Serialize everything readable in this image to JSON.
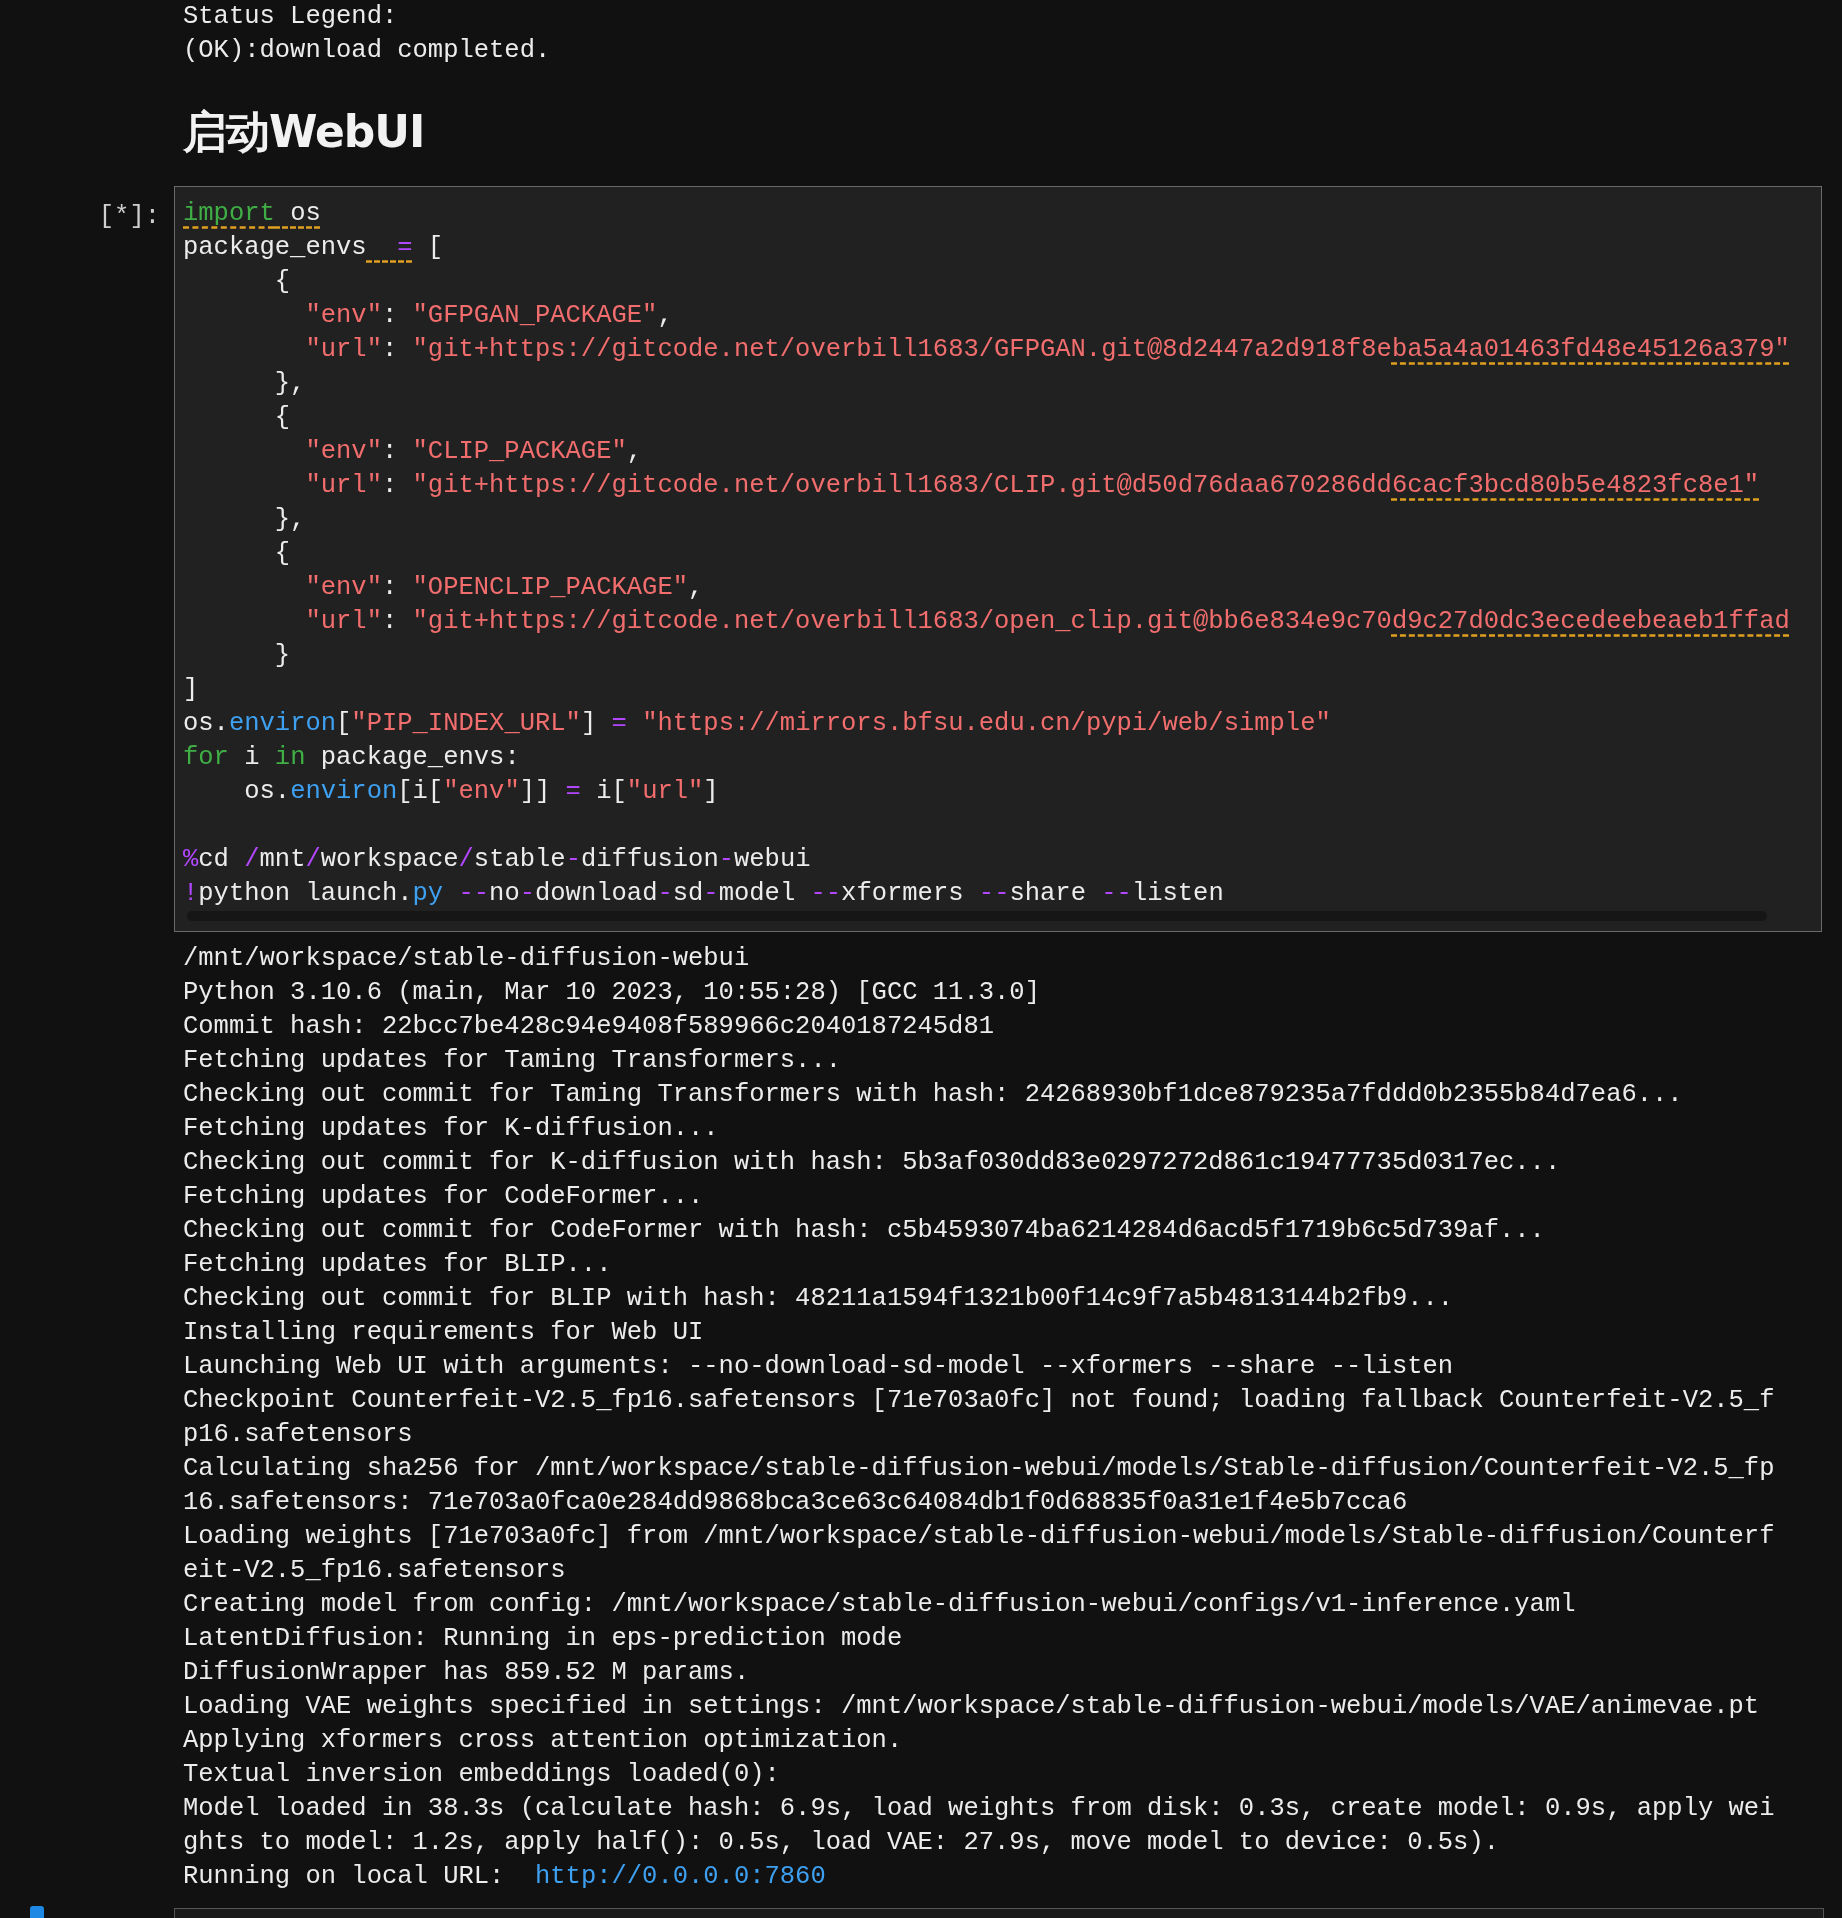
{
  "previous_output": [
    "Status Legend:",
    "(OK):download completed."
  ],
  "heading": "启动WebUI",
  "cell": {
    "prompt": "[*]:",
    "running": true,
    "code_blocks": [
      [
        [
          {
            "kind": "keyword",
            "t": "import",
            "lint": true
          },
          {
            "kind": "plain",
            "t": " os",
            "lint": true
          }
        ],
        [
          {
            "kind": "plain",
            "t": "package_envs"
          },
          {
            "kind": "operator",
            "t": "  =",
            "lint": true
          },
          {
            "kind": "plain",
            "t": " ["
          }
        ],
        [
          {
            "kind": "plain",
            "t": "      {"
          }
        ],
        [
          {
            "kind": "string",
            "t": "        \"env\""
          },
          {
            "kind": "plain",
            "t": ": "
          },
          {
            "kind": "string",
            "t": "\"GFPGAN_PACKAGE\""
          },
          {
            "kind": "plain",
            "t": ","
          }
        ],
        [
          {
            "kind": "string",
            "t": "        \"url\""
          },
          {
            "kind": "plain",
            "t": ": "
          },
          {
            "kind": "string",
            "t": "\"git+https://gitcode.net/overbill1683/GFPGAN.git@8d2447a2d918f8e"
          },
          {
            "kind": "string",
            "t": "ba5a4a01463fd48e45126a379\"",
            "lint": true
          }
        ],
        [
          {
            "kind": "plain",
            "t": "      },"
          }
        ],
        [
          {
            "kind": "plain",
            "t": "      {"
          }
        ],
        [
          {
            "kind": "string",
            "t": "        \"env\""
          },
          {
            "kind": "plain",
            "t": ": "
          },
          {
            "kind": "string",
            "t": "\"CLIP_PACKAGE\""
          },
          {
            "kind": "plain",
            "t": ","
          }
        ],
        [
          {
            "kind": "string",
            "t": "        \"url\""
          },
          {
            "kind": "plain",
            "t": ": "
          },
          {
            "kind": "string",
            "t": "\"git+https://gitcode.net/overbill1683/CLIP.git@d50d76daa670286dd"
          },
          {
            "kind": "string",
            "t": "6cacf3bcd80b5e4823fc8e1\"",
            "lint": true
          }
        ],
        [
          {
            "kind": "plain",
            "t": "      },"
          }
        ],
        [
          {
            "kind": "plain",
            "t": "      {"
          }
        ],
        [
          {
            "kind": "string",
            "t": "        \"env\""
          },
          {
            "kind": "plain",
            "t": ": "
          },
          {
            "kind": "string",
            "t": "\"OPENCLIP_PACKAGE\""
          },
          {
            "kind": "plain",
            "t": ","
          }
        ],
        [
          {
            "kind": "string",
            "t": "        \"url\""
          },
          {
            "kind": "plain",
            "t": ": "
          },
          {
            "kind": "string",
            "t": "\"git+https://gitcode.net/overbill1683/open_clip.git@bb6e834e9c70"
          },
          {
            "kind": "string",
            "t": "d9c27d0dc3ecedeebeaeb1ffad",
            "lint": true
          }
        ],
        [
          {
            "kind": "plain",
            "t": "      }"
          }
        ],
        [
          {
            "kind": "plain",
            "t": "]"
          }
        ],
        [
          {
            "kind": "plain",
            "t": "os."
          },
          {
            "kind": "attribute",
            "t": "environ"
          },
          {
            "kind": "plain",
            "t": "["
          },
          {
            "kind": "string",
            "t": "\"PIP_INDEX_URL\""
          },
          {
            "kind": "plain",
            "t": "] "
          },
          {
            "kind": "operator",
            "t": "="
          },
          {
            "kind": "string",
            "t": " \"https://mirrors.bfsu.edu.cn/pypi/web/simple\""
          }
        ],
        [
          {
            "kind": "keyword",
            "t": "for"
          },
          {
            "kind": "plain",
            "t": " i "
          },
          {
            "kind": "keyword",
            "t": "in"
          },
          {
            "kind": "plain",
            "t": " package_envs:"
          }
        ],
        [
          {
            "kind": "plain",
            "t": "    os."
          },
          {
            "kind": "attribute",
            "t": "environ"
          },
          {
            "kind": "plain",
            "t": "[i["
          },
          {
            "kind": "string",
            "t": "\"env\""
          },
          {
            "kind": "plain",
            "t": "]] "
          },
          {
            "kind": "operator",
            "t": "="
          },
          {
            "kind": "plain",
            "t": " i["
          },
          {
            "kind": "string",
            "t": "\"url\""
          },
          {
            "kind": "plain",
            "t": "]"
          }
        ]
      ],
      [
        [
          {
            "kind": "operator",
            "t": "%"
          },
          {
            "kind": "plain",
            "t": "cd "
          },
          {
            "kind": "operator",
            "t": "/"
          },
          {
            "kind": "plain",
            "t": "mnt"
          },
          {
            "kind": "operator",
            "t": "/"
          },
          {
            "kind": "plain",
            "t": "workspace"
          },
          {
            "kind": "operator",
            "t": "/"
          },
          {
            "kind": "plain",
            "t": "stable"
          },
          {
            "kind": "operator",
            "t": "-"
          },
          {
            "kind": "plain",
            "t": "diffusion"
          },
          {
            "kind": "operator",
            "t": "-"
          },
          {
            "kind": "plain",
            "t": "webui"
          }
        ],
        [
          {
            "kind": "operator",
            "t": "!"
          },
          {
            "kind": "plain",
            "t": "python launch."
          },
          {
            "kind": "attribute",
            "t": "py"
          },
          {
            "kind": "operator",
            "t": " --"
          },
          {
            "kind": "plain",
            "t": "no"
          },
          {
            "kind": "operator",
            "t": "-"
          },
          {
            "kind": "plain",
            "t": "download"
          },
          {
            "kind": "operator",
            "t": "-"
          },
          {
            "kind": "plain",
            "t": "sd"
          },
          {
            "kind": "operator",
            "t": "-"
          },
          {
            "kind": "plain",
            "t": "model "
          },
          {
            "kind": "operator",
            "t": "--"
          },
          {
            "kind": "plain",
            "t": "xformers "
          },
          {
            "kind": "operator",
            "t": "--"
          },
          {
            "kind": "plain",
            "t": "share "
          },
          {
            "kind": "operator",
            "t": "--"
          },
          {
            "kind": "plain",
            "t": "listen"
          }
        ]
      ]
    ]
  },
  "output": [
    {
      "text": "/mnt/workspace/stable-diffusion-webui"
    },
    {
      "text": "Python 3.10.6 (main, Mar 10 2023, 10:55:28) [GCC 11.3.0]"
    },
    {
      "text": "Commit hash: 22bcc7be428c94e9408f589966c2040187245d81"
    },
    {
      "text": "Fetching updates for Taming Transformers..."
    },
    {
      "text": "Checking out commit for Taming Transformers with hash: 24268930bf1dce879235a7fddd0b2355b84d7ea6..."
    },
    {
      "text": "Fetching updates for K-diffusion..."
    },
    {
      "text": "Checking out commit for K-diffusion with hash: 5b3af030dd83e0297272d861c19477735d0317ec..."
    },
    {
      "text": "Fetching updates for CodeFormer..."
    },
    {
      "text": "Checking out commit for CodeFormer with hash: c5b4593074ba6214284d6acd5f1719b6c5d739af..."
    },
    {
      "text": "Fetching updates for BLIP..."
    },
    {
      "text": "Checking out commit for BLIP with hash: 48211a1594f1321b00f14c9f7a5b4813144b2fb9..."
    },
    {
      "text": "Installing requirements for Web UI"
    },
    {
      "text": "Launching Web UI with arguments: --no-download-sd-model --xformers --share --listen"
    },
    {
      "text": "Checkpoint Counterfeit-V2.5_fp16.safetensors [71e703a0fc] not found; loading fallback Counterfeit-V2.5_f"
    },
    {
      "text": "p16.safetensors"
    },
    {
      "text": "Calculating sha256 for /mnt/workspace/stable-diffusion-webui/models/Stable-diffusion/Counterfeit-V2.5_fp"
    },
    {
      "text": "16.safetensors: 71e703a0fca0e284dd9868bca3ce63c64084db1f0d68835f0a31e1f4e5b7cca6"
    },
    {
      "text": "Loading weights [71e703a0fc] from /mnt/workspace/stable-diffusion-webui/models/Stable-diffusion/Counterf"
    },
    {
      "text": "eit-V2.5_fp16.safetensors"
    },
    {
      "text": "Creating model from config: /mnt/workspace/stable-diffusion-webui/configs/v1-inference.yaml"
    },
    {
      "text": "LatentDiffusion: Running in eps-prediction mode"
    },
    {
      "text": "DiffusionWrapper has 859.52 M params."
    },
    {
      "text": "Loading VAE weights specified in settings: /mnt/workspace/stable-diffusion-webui/models/VAE/animevae.pt"
    },
    {
      "text": "Applying xformers cross attention optimization."
    },
    {
      "text": "Textual inversion embeddings loaded(0):"
    },
    {
      "text": "Model loaded in 38.3s (calculate hash: 6.9s, load weights from disk: 0.3s, create model: 0.9s, apply wei"
    },
    {
      "text": "ghts to model: 1.2s, apply half(): 0.5s, load VAE: 27.9s, move model to device: 0.5s)."
    },
    {
      "text": "Running on local URL:",
      "link": "http://0.0.0.0:7860"
    }
  ]
}
